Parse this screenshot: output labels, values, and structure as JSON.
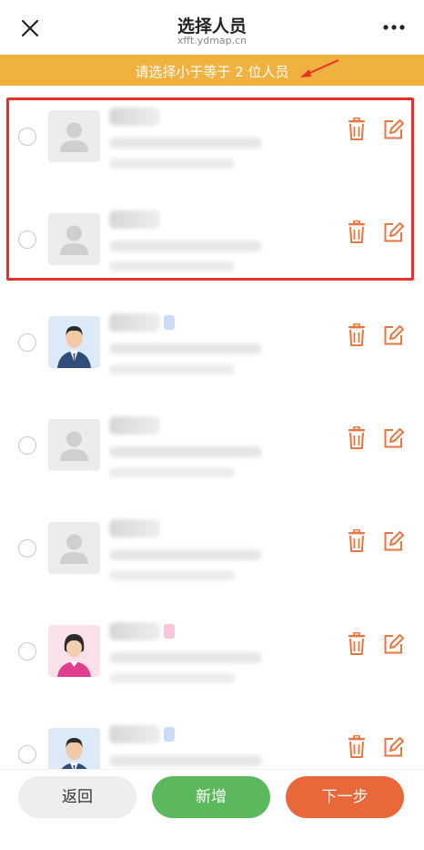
{
  "header": {
    "title": "选择人员",
    "subtitle": "xfft.ydmap.cn"
  },
  "notice": {
    "text": "请选择小于等于 2 位人员"
  },
  "icons": {
    "close": "close-icon",
    "more": "more-dots-icon",
    "delete": "trash-icon",
    "edit": "edit-pencil-icon",
    "default_avatar": "person-placeholder-icon"
  },
  "colors": {
    "notice_bg": "#f1b13f",
    "action_icon": "#e8763f",
    "highlight_border": "#e8302b",
    "add_button": "#5cb85c",
    "next_button": "#e9683a"
  },
  "persons": [
    {
      "avatar": "placeholder",
      "selected": false
    },
    {
      "avatar": "placeholder",
      "selected": false
    },
    {
      "avatar": "male",
      "selected": false
    },
    {
      "avatar": "placeholder",
      "selected": false
    },
    {
      "avatar": "placeholder",
      "selected": false
    },
    {
      "avatar": "female",
      "selected": false
    },
    {
      "avatar": "male",
      "selected": false
    }
  ],
  "footer": {
    "back_label": "返回",
    "add_label": "新增",
    "next_label": "下一步"
  }
}
